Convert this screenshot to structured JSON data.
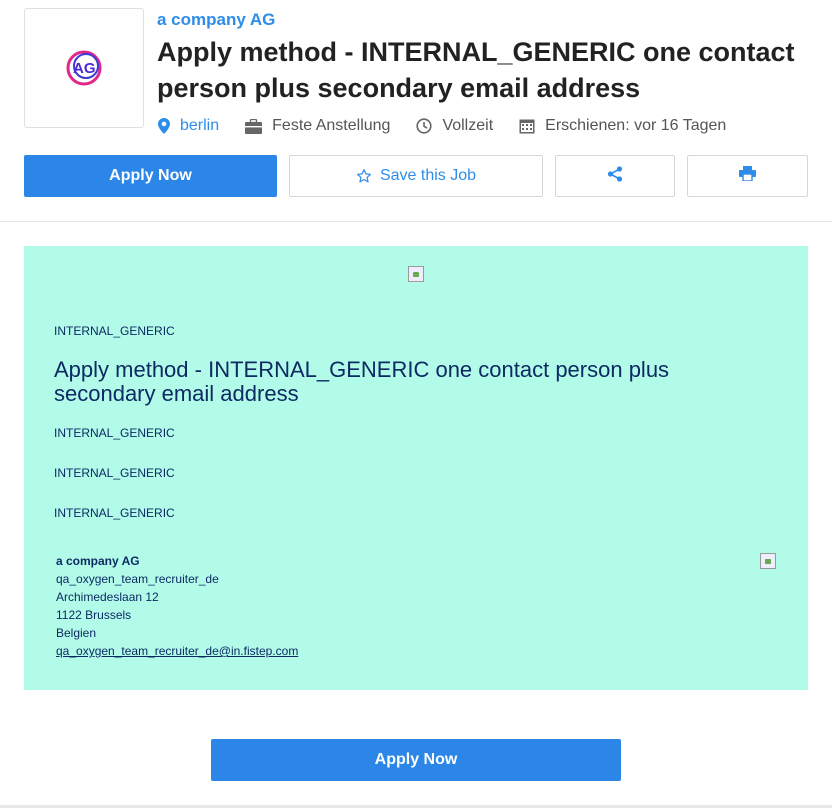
{
  "header": {
    "company_name": "a company AG",
    "logo_text": "AG",
    "title": "Apply method - INTERNAL_GENERIC one contact person plus secondary email address",
    "meta": {
      "location": "berlin",
      "contract": "Feste Anstellung",
      "schedule": "Vollzeit",
      "published": "Erschienen: vor 16 Tagen"
    }
  },
  "actions": {
    "apply_label": "Apply Now",
    "save_label": "Save this Job",
    "share_icon": "share-icon",
    "print_icon": "print-icon"
  },
  "panel": {
    "background": "#b2fbe9",
    "label_1": "INTERNAL_GENERIC",
    "heading": "Apply method - INTERNAL_GENERIC one contact person plus secondary email address",
    "label_2": "INTERNAL_GENERIC",
    "label_3": "INTERNAL_GENERIC",
    "label_4": "INTERNAL_GENERIC",
    "contact": {
      "company": "a company AG",
      "recruiter": "qa_oxygen_team_recruiter_de",
      "street": "Archimedeslaan 12",
      "city": "1122 Brussels",
      "country": "Belgien",
      "email": "qa_oxygen_team_recruiter_de@in.fistep.com"
    }
  },
  "footer": {
    "apply_label": "Apply Now"
  },
  "colors": {
    "accent": "#2b86e8",
    "link": "#2d8de8",
    "panel_text": "#0d2a63"
  }
}
